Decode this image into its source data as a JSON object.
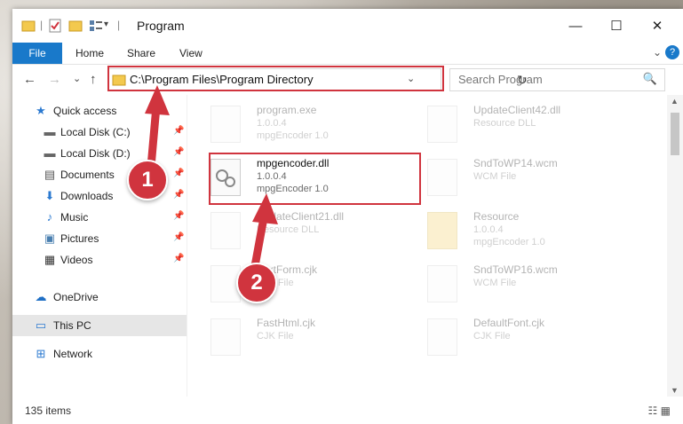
{
  "window": {
    "title": "Program",
    "controls": {
      "minimize": "—",
      "maximize": "☐",
      "close": "✕"
    }
  },
  "quick_access_toolbar": {
    "separator": "|",
    "dropdown": "▾"
  },
  "ribbon": {
    "tabs": [
      "File",
      "Home",
      "Share",
      "View"
    ],
    "expand_icon": "⌄",
    "help_icon": "?"
  },
  "nav": {
    "back_icon": "←",
    "forward_icon": "→",
    "recent_icon": "⌄",
    "up_icon": "↑",
    "address": "C:\\Program Files\\Program Directory",
    "address_dropdown": "⌄",
    "refresh_icon": "↻",
    "search_placeholder": "Search Program",
    "search_icon": "🔍"
  },
  "sidebar": {
    "items": [
      {
        "label": "Quick access",
        "icon": "star-icon",
        "glyph": "★",
        "color": "#2b79d0",
        "pinned": false
      },
      {
        "label": "Local Disk (C:)",
        "icon": "drive-icon",
        "glyph": "▬",
        "color": "#666666",
        "pinned": true
      },
      {
        "label": "Local Disk (D:)",
        "icon": "drive-icon",
        "glyph": "▬",
        "color": "#666666",
        "pinned": true
      },
      {
        "label": "Documents",
        "icon": "documents-icon",
        "glyph": "▤",
        "color": "#555555",
        "pinned": true
      },
      {
        "label": "Downloads",
        "icon": "downloads-icon",
        "glyph": "⬇",
        "color": "#2b79d0",
        "pinned": true
      },
      {
        "label": "Music",
        "icon": "music-icon",
        "glyph": "♪",
        "color": "#2b79d0",
        "pinned": true
      },
      {
        "label": "Pictures",
        "icon": "pictures-icon",
        "glyph": "▣",
        "color": "#4a7fb0",
        "pinned": true
      },
      {
        "label": "Videos",
        "icon": "videos-icon",
        "glyph": "▦",
        "color": "#333333",
        "pinned": true
      },
      {
        "label": "OneDrive",
        "icon": "cloud-icon",
        "glyph": "☁",
        "color": "#1f6fc5",
        "pinned": false
      },
      {
        "label": "This PC",
        "icon": "computer-icon",
        "glyph": "▭",
        "color": "#2b79d0",
        "pinned": false,
        "selected": true
      },
      {
        "label": "Network",
        "icon": "network-icon",
        "glyph": "⊞",
        "color": "#2b79d0",
        "pinned": false
      }
    ],
    "pin_glyph": "📌"
  },
  "files": [
    {
      "name": "program.exe",
      "line2": "1.0.0.4",
      "line3": "mpgEncoder 1.0",
      "faded": true
    },
    {
      "name": "UpdateClient42.dll",
      "line2": "Resource DLL",
      "line3": "",
      "faded": true
    },
    {
      "name": "mpgencoder.dll",
      "line2": "1.0.0.4",
      "line3": "mpgEncoder 1.0",
      "faded": false
    },
    {
      "name": "SndToWP14.wcm",
      "line2": "WCM File",
      "line3": "",
      "faded": true
    },
    {
      "name": "UpdateClient21.dll",
      "line2": "Resource DLL",
      "line3": "",
      "faded": true
    },
    {
      "name": "Resource",
      "line2": "1.0.0.4",
      "line3": "mpgEncoder 1.0",
      "faded": true
    },
    {
      "name": "TextForm.cjk",
      "line2": "CJK File",
      "line3": "",
      "faded": true
    },
    {
      "name": "SndToWP16.wcm",
      "line2": "WCM File",
      "line3": "",
      "faded": true
    },
    {
      "name": "FastHtml.cjk",
      "line2": "CJK File",
      "line3": "",
      "faded": true
    },
    {
      "name": "DefaultFont.cjk",
      "line2": "CJK File",
      "line3": "",
      "faded": true
    }
  ],
  "status": {
    "count": "135 items",
    "details_view": "☷",
    "tiles_view": "▦"
  },
  "scroll": {
    "up": "▲",
    "down": "▼"
  },
  "annotations": {
    "step1": "1",
    "step2": "2"
  },
  "colors": {
    "accent": "#1979ca",
    "highlight": "#d0343e"
  }
}
